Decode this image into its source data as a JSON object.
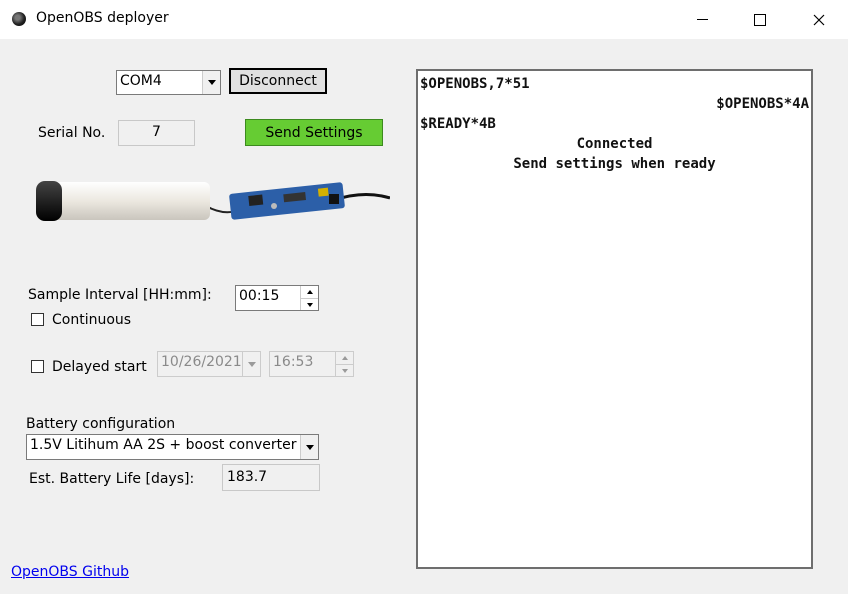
{
  "window": {
    "title": "OpenOBS deployer",
    "icon": "openobs-logo-icon"
  },
  "connection": {
    "port": "COM4",
    "disconnect_label": "Disconnect"
  },
  "serial": {
    "label": "Serial No.",
    "value": "7"
  },
  "send_settings_label": "Send Settings",
  "sampling": {
    "interval_label": "Sample Interval [HH:mm]:",
    "interval_value": "00:15",
    "continuous_label": "Continuous",
    "continuous_checked": false
  },
  "delayed_start": {
    "label": "Delayed start",
    "checked": false,
    "date": "10/26/2021",
    "time": "16:53"
  },
  "battery": {
    "config_label": "Battery configuration",
    "config_value": "1.5V Litihum AA 2S + boost converter",
    "life_label": "Est. Battery Life [days]:",
    "life_value": "183.7"
  },
  "github_link": "OpenOBS Github",
  "console_lines": [
    {
      "text": "$OPENOBS,7*51",
      "align": "left"
    },
    {
      "text": "$OPENOBS*4A",
      "align": "right"
    },
    {
      "text": "$READY*4B",
      "align": "left"
    },
    {
      "text": "Connected",
      "align": "center"
    },
    {
      "text": "Send settings when ready",
      "align": "center"
    }
  ],
  "colors": {
    "send_button": "#66cc33",
    "link": "#0000ee"
  }
}
